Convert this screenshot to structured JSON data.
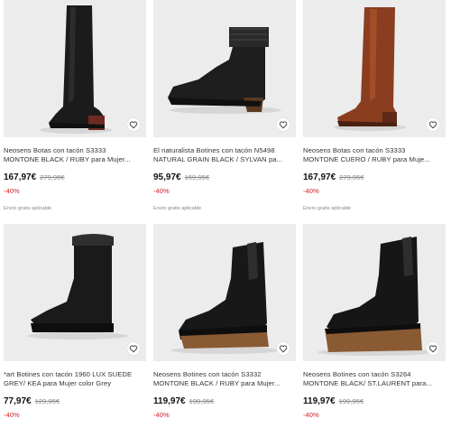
{
  "products": [
    {
      "title_line1": "Neosens Botas con tacón S3333",
      "title_line2": "MONTONE BLACK / RUBY para Mujer...",
      "price": "167,97€",
      "old_price": "279,95€",
      "discount": "-40%",
      "shipping": "Envío gratis aplicable",
      "favorite_icon": "heart-icon"
    },
    {
      "title_line1": "El naturalista Botines con tacón N5498",
      "title_line2": "NATURAL GRAIN BLACK / SYLVAN pa...",
      "price": "95,97€",
      "old_price": "159,95€",
      "discount": "-40%",
      "shipping": "Envío gratis aplicable",
      "favorite_icon": "heart-icon"
    },
    {
      "title_line1": "Neosens Botas con tacón S3333",
      "title_line2": "MONTONE CUERO / RUBY para Muje...",
      "price": "167,97€",
      "old_price": "279,95€",
      "discount": "-40%",
      "shipping": "Envío gratis aplicable",
      "favorite_icon": "heart-icon"
    },
    {
      "title_line1": "*art Botines con tacón 1960 LUX SUEDE",
      "title_line2": "GREY/ KEA para Mujer color Grey",
      "price": "77,97€",
      "old_price": "129,95€",
      "discount": "-40%",
      "favorite_icon": "heart-icon"
    },
    {
      "title_line1": "Neosens Botines con tacón S3332",
      "title_line2": "MONTONE BLACK / RUBY para Mujer...",
      "price": "119,97€",
      "old_price": "199,95€",
      "discount": "-40%",
      "favorite_icon": "heart-icon"
    },
    {
      "title_line1": "Neosens Botines con tacón S3264",
      "title_line2": "MONTONE BLACK/ ST.LAURENT para...",
      "price": "119,97€",
      "old_price": "199,95€",
      "discount": "-40%",
      "favorite_icon": "heart-icon"
    }
  ],
  "colors": {
    "discount": "#d2232a",
    "image_background": "#ececec",
    "boot_black": "#1b1b1b",
    "boot_brown": "#8a3e1f",
    "heel_wood": "#8a5a33"
  }
}
